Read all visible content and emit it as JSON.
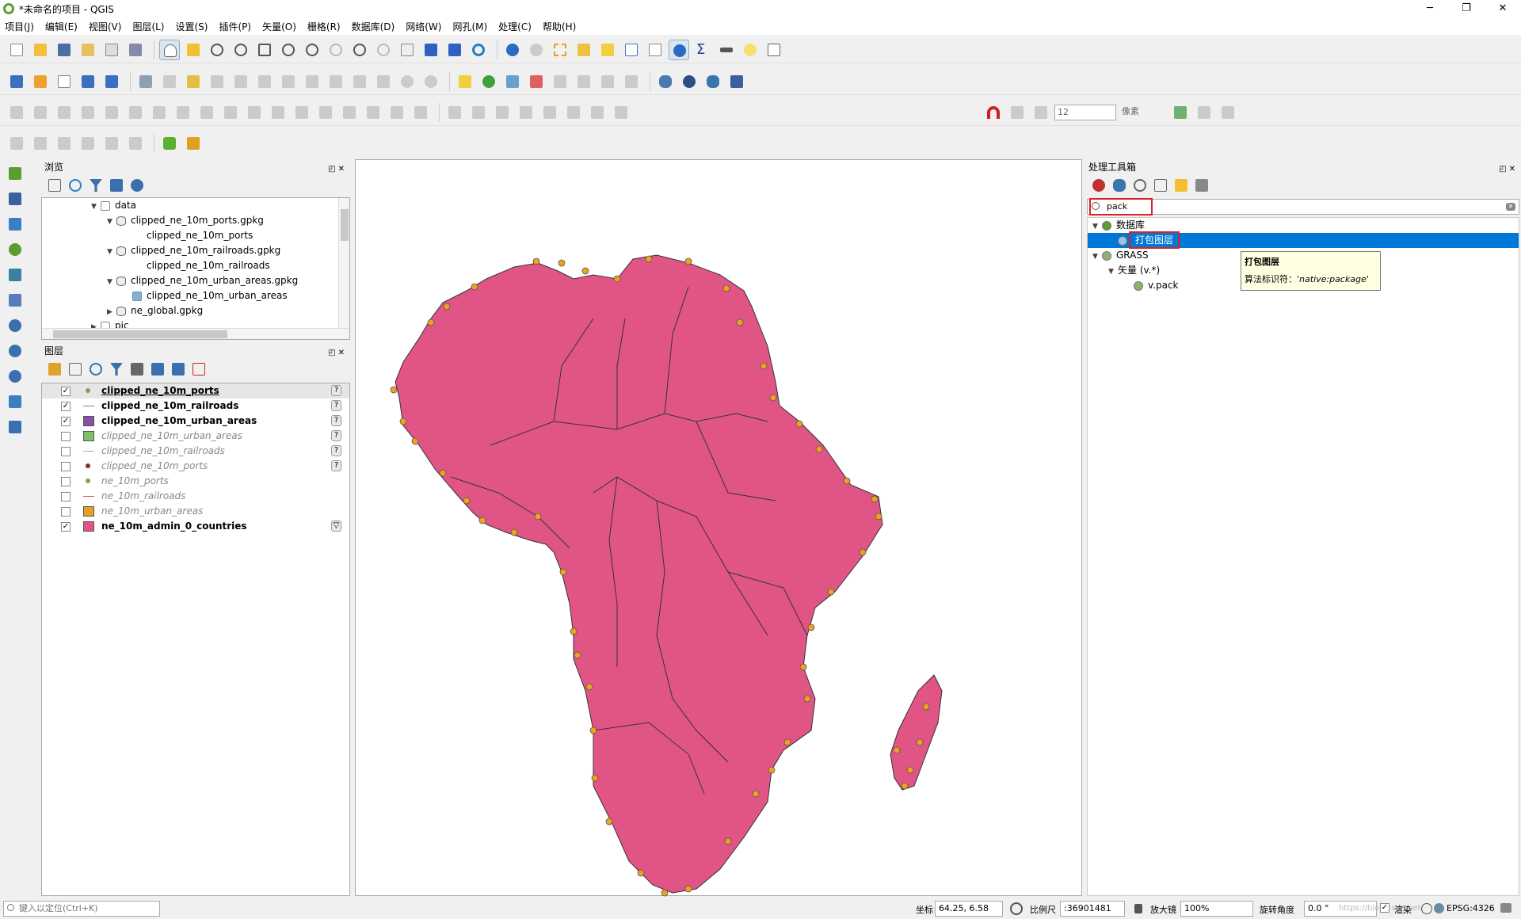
{
  "window": {
    "title": "*未命名的项目 - QGIS",
    "minimize": "─",
    "maximize": "❐",
    "close": "✕"
  },
  "menu": [
    "项目(J)",
    "编辑(E)",
    "视图(V)",
    "图层(L)",
    "设置(S)",
    "插件(P)",
    "矢量(O)",
    "栅格(R)",
    "数据库(D)",
    "网络(W)",
    "网孔(M)",
    "处理(C)",
    "帮助(H)"
  ],
  "snapping": {
    "tolerance": "12",
    "units": "像素"
  },
  "browser": {
    "title": "浏览",
    "items": [
      {
        "label": "data",
        "level": 0,
        "arrow": "▼",
        "icon": "folder"
      },
      {
        "label": "clipped_ne_10m_ports.gpkg",
        "level": 1,
        "arrow": "▼",
        "icon": "db"
      },
      {
        "label": "clipped_ne_10m_ports",
        "level": 2,
        "arrow": "",
        "icon": "points"
      },
      {
        "label": "clipped_ne_10m_railroads.gpkg",
        "level": 1,
        "arrow": "▼",
        "icon": "db"
      },
      {
        "label": "clipped_ne_10m_railroads",
        "level": 2,
        "arrow": "",
        "icon": "line"
      },
      {
        "label": "clipped_ne_10m_urban_areas.gpkg",
        "level": 1,
        "arrow": "▼",
        "icon": "db"
      },
      {
        "label": "clipped_ne_10m_urban_areas",
        "level": 2,
        "arrow": "",
        "icon": "polygon"
      },
      {
        "label": "ne_global.gpkg",
        "level": 1,
        "arrow": "▶",
        "icon": "db"
      },
      {
        "label": "pic",
        "level": 0,
        "arrow": "▶",
        "icon": "folder"
      }
    ]
  },
  "layers": {
    "title": "图层",
    "items": [
      {
        "name": "clipped_ne_10m_ports",
        "checked": true,
        "symbol": "point",
        "color": "#8b9b5c",
        "state": "on",
        "underline": true,
        "q": "?"
      },
      {
        "name": "clipped_ne_10m_railroads",
        "checked": true,
        "symbol": "line",
        "color": "#9a7a6a",
        "state": "on",
        "q": "?"
      },
      {
        "name": "clipped_ne_10m_urban_areas",
        "checked": true,
        "symbol": "fill",
        "color": "#8a4fa8",
        "state": "on",
        "q": "?"
      },
      {
        "name": "clipped_ne_10m_urban_areas",
        "checked": false,
        "symbol": "fill",
        "color": "#7fbf6a",
        "state": "off",
        "q": "?"
      },
      {
        "name": "clipped_ne_10m_railroads",
        "checked": false,
        "symbol": "line",
        "color": "#aaaaaa",
        "state": "off",
        "q": "?"
      },
      {
        "name": "clipped_ne_10m_ports",
        "checked": false,
        "symbol": "point",
        "color": "#8b2a2a",
        "state": "off",
        "q": "?"
      },
      {
        "name": "ne_10m_ports",
        "checked": false,
        "symbol": "point",
        "color": "#8b9b5c",
        "state": "off",
        "q": ""
      },
      {
        "name": "ne_10m_railroads",
        "checked": false,
        "symbol": "line",
        "color": "#d9534f",
        "state": "off",
        "q": ""
      },
      {
        "name": "ne_10m_urban_areas",
        "checked": false,
        "symbol": "fill",
        "color": "#e8a020",
        "state": "off",
        "q": ""
      },
      {
        "name": "ne_10m_admin_0_countries",
        "checked": true,
        "symbol": "fill",
        "color": "#e05585",
        "state": "on",
        "q": "▽"
      }
    ]
  },
  "processing": {
    "title": "处理工具箱",
    "search_value": "pack",
    "tree": [
      {
        "label": "数据库",
        "level": 0,
        "arrow": "▼",
        "icon": "qgis"
      },
      {
        "label": "打包图层",
        "level": 1,
        "arrow": "",
        "icon": "gear",
        "selected": true
      },
      {
        "label": "GRASS",
        "level": 0,
        "arrow": "▼",
        "icon": "grass"
      },
      {
        "label": "矢量 (v.*)",
        "level": 1,
        "arrow": "▼",
        "icon": ""
      },
      {
        "label": "v.pack",
        "level": 2,
        "arrow": "",
        "icon": "grass"
      }
    ],
    "tooltip": {
      "title": "打包图层",
      "line_label": "算法标识符：",
      "line_value": "'native:package'"
    }
  },
  "status": {
    "locator_placeholder": "键入以定位(Ctrl+K)",
    "coord_label": "坐标",
    "coord_value": "64.25, 6.58",
    "scale_label": "比例尺",
    "scale_value": ":36901481",
    "magnifier_label": "放大镜",
    "magnifier_value": "100%",
    "rotation_label": "旋转角度",
    "rotation_value": "0.0 °",
    "render_label": "渲染",
    "crs": "EPSG:4326",
    "watermark": "https://blog.csdn.net/"
  },
  "colors": {
    "countries": "#e05585",
    "ports": "#f0a020",
    "selection": "#0078d7",
    "highlight_box": "#e02020"
  }
}
